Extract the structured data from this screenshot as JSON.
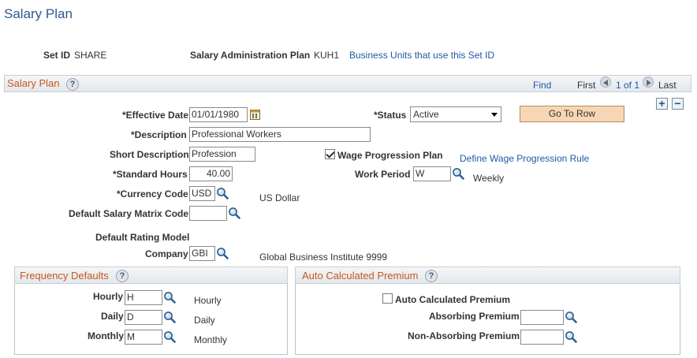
{
  "page": {
    "title": "Salary Plan"
  },
  "header": {
    "setid_label": "Set ID",
    "setid_value": "SHARE",
    "plan_label": "Salary Administration Plan",
    "plan_value": "KUH1",
    "bu_link": "Business Units that use this Set ID"
  },
  "section": {
    "title": "Salary Plan",
    "find": "Find",
    "first": "First",
    "range": "1 of 1",
    "last": "Last"
  },
  "form": {
    "effdt_label": "*Effective Date",
    "effdt_value": "01/01/1980",
    "status_label": "*Status",
    "status_value": "Active",
    "goto_label": "Go To Row",
    "descr_label": "*Description",
    "descr_value": "Professional Workers",
    "short_label": "Short Description",
    "short_value": "Profession",
    "wage_label": "Wage Progression Plan",
    "wage_checked": true,
    "wage_link": "Define Wage Progression Rule",
    "std_label": "*Standard Hours",
    "std_value": "40.00",
    "workper_label": "Work Period",
    "workper_value": "W",
    "workper_desc": "Weekly",
    "curr_label": "*Currency Code",
    "curr_value": "USD",
    "curr_desc": "US Dollar",
    "matrix_label": "Default Salary Matrix Code",
    "matrix_value": "",
    "rating_label": "Default Rating Model",
    "company_label": "Company",
    "company_value": "GBI",
    "company_desc": "Global Business Institute 9999"
  },
  "freq": {
    "title": "Frequency Defaults",
    "hourly_label": "Hourly",
    "hourly_value": "H",
    "hourly_desc": "Hourly",
    "daily_label": "Daily",
    "daily_value": "D",
    "daily_desc": "Daily",
    "monthly_label": "Monthly",
    "monthly_value": "M",
    "monthly_desc": "Monthly"
  },
  "auto": {
    "title": "Auto Calculated Premium",
    "check_label": "Auto Calculated Premium",
    "checked": false,
    "absorb_label": "Absorbing Premium",
    "absorb_value": "",
    "nonabsorb_label": "Non-Absorbing Premium",
    "nonabsorb_value": ""
  },
  "icons": {
    "lookup": "magnifier-icon",
    "help": "help-icon",
    "calendar": "calendar-icon",
    "add": "plus-icon",
    "delete": "minus-icon"
  },
  "colors": {
    "title": "#2e5a8c",
    "section_title": "#c8571b",
    "link": "#1f5aa6",
    "button": "#f7d6b5"
  }
}
